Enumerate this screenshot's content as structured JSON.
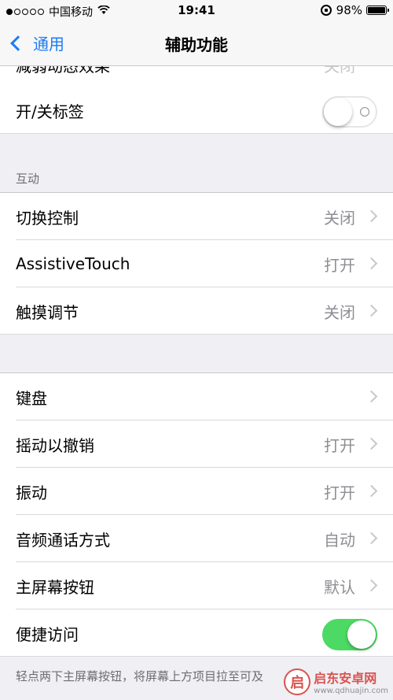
{
  "status": {
    "carrier": "中国移动",
    "time": "19:41",
    "battery": "98%",
    "signal_bars_filled": 1,
    "signal_bars_total": 5
  },
  "nav": {
    "back_label": "通用",
    "title": "辅助功能"
  },
  "partial_row": {
    "label": "减弱动态效果",
    "value": "关闭"
  },
  "labels_row": {
    "label": "开/关标签",
    "toggle_on": false
  },
  "interaction": {
    "header": "互动",
    "rows": [
      {
        "label": "切换控制",
        "value": "关闭"
      },
      {
        "label": "AssistiveTouch",
        "value": "打开"
      },
      {
        "label": "触摸调节",
        "value": "关闭"
      }
    ]
  },
  "more": {
    "rows": [
      {
        "label": "键盘",
        "value": ""
      },
      {
        "label": "摇动以撤销",
        "value": "打开"
      },
      {
        "label": "振动",
        "value": "打开"
      },
      {
        "label": "音频通话方式",
        "value": "自动"
      },
      {
        "label": "主屏幕按钮",
        "value": "默认"
      }
    ],
    "reachability": {
      "label": "便捷访问",
      "toggle_on": true
    }
  },
  "footer": "轻点两下主屏幕按钮，将屏幕上方项目拉至可及",
  "watermark": {
    "name": "启东安卓网",
    "url": "www.qdhuajin.com"
  },
  "colors": {
    "accent": "#1a7cf5",
    "switch_on": "#4cd964",
    "background": "#efeff4"
  }
}
